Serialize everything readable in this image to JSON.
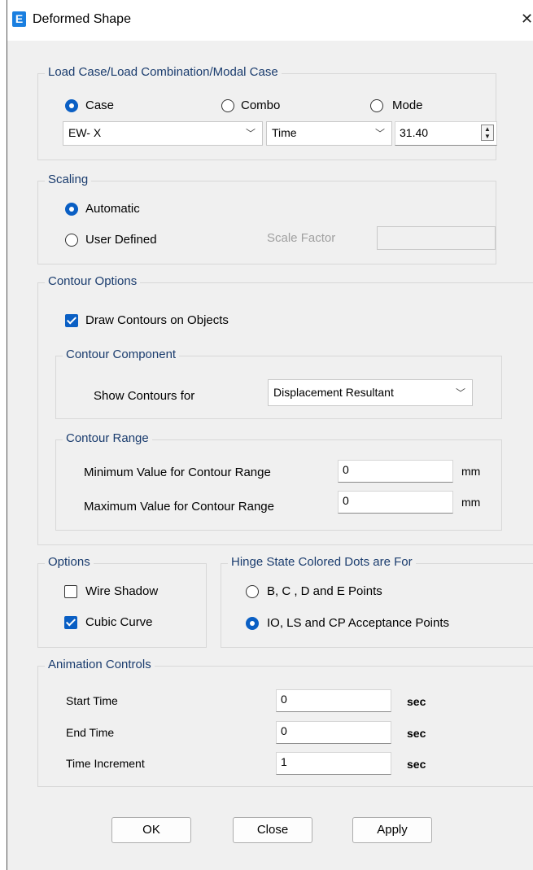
{
  "window": {
    "title": "Deformed Shape",
    "app_icon_letter": "E",
    "close_glyph": "✕"
  },
  "load_case": {
    "legend": "Load Case/Load Combination/Modal Case",
    "options": {
      "case": "Case",
      "combo": "Combo",
      "mode": "Mode"
    },
    "selected": "case",
    "case_value": "EW- X",
    "type_value": "Time",
    "time_value": "31.40"
  },
  "scaling": {
    "legend": "Scaling",
    "automatic": "Automatic",
    "user_defined": "User Defined",
    "selected": "automatic",
    "scale_factor_label": "Scale Factor",
    "scale_factor_value": ""
  },
  "contour": {
    "legend": "Contour Options",
    "draw_contours_label": "Draw Contours on Objects",
    "draw_contours_checked": true,
    "component": {
      "legend": "Contour Component",
      "show_label": "Show Contours for",
      "show_value": "Displacement Resultant"
    },
    "range": {
      "legend": "Contour Range",
      "min_label": "Minimum Value for Contour Range",
      "min_value": "0",
      "max_label": "Maximum Value for Contour Range",
      "max_value": "0",
      "unit": "mm"
    }
  },
  "options": {
    "legend": "Options",
    "wire_shadow": "Wire Shadow",
    "wire_shadow_checked": false,
    "cubic_curve": "Cubic Curve",
    "cubic_curve_checked": true
  },
  "hinge": {
    "legend": "Hinge State Colored Dots are For",
    "bcde": "B, C , D and E Points",
    "io_ls_cp": "IO, LS and CP Acceptance Points",
    "selected": "io_ls_cp"
  },
  "animation": {
    "legend": "Animation Controls",
    "start_label": "Start Time",
    "start_value": "0",
    "end_label": "End Time",
    "end_value": "0",
    "increment_label": "Time Increment",
    "increment_value": "1",
    "unit": "sec"
  },
  "buttons": {
    "ok": "OK",
    "close": "Close",
    "apply": "Apply"
  },
  "icons": {
    "dropdown": "chevron-down-icon",
    "spinner": "spin-updown-icon",
    "close": "close-icon"
  },
  "colors": {
    "accent": "#0a5fc4",
    "legend_text": "#1a3c6e",
    "dialog_bg": "#f0f0f0"
  }
}
